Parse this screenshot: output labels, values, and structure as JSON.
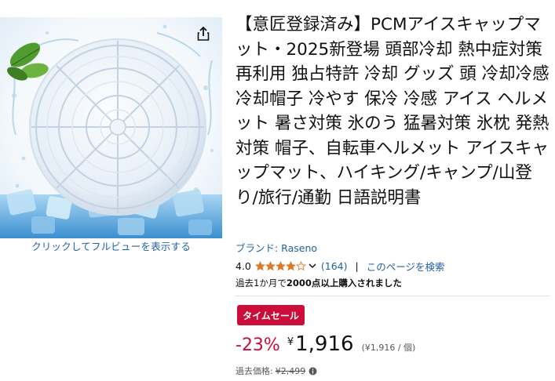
{
  "image": {
    "share_icon": "share-icon",
    "fullview_label": "クリックしてフルビューを表示する"
  },
  "product": {
    "title": "【意匠登録済み】PCMアイスキャップマット・2025新登場 頭部冷却 熱中症対策 再利用 独占特許 冷却 グッズ 頭 冷却冷感 冷却帽子 冷やす 保冷 冷感 アイス ヘルメット 暑さ対策 氷のう 猛暑対策 氷枕 発熱対策 帽子、自転車ヘルメット アイスキャップマット、ハイキング/キャンプ/山登り/旅行/通勤 日語説明書",
    "brand_label": "ブランド: Raseno"
  },
  "rating": {
    "value": "4.0",
    "stars": 4.0,
    "review_count": "(164)",
    "separator": "|",
    "search_link": "このページを検索",
    "star_color": "#de7921"
  },
  "sales": {
    "bought_prefix": "過去1か月で",
    "bought_bold": "2000点以上購入されました"
  },
  "deal": {
    "badge_label": "タイムセール",
    "badge_color": "#cc0c39"
  },
  "price": {
    "discount": "-23%",
    "currency": "¥",
    "amount": "1,916",
    "unit_price": "(¥1,916 / 個)",
    "list_label": "過去価格:",
    "list_price": "¥2,499",
    "info_icon": "info-icon"
  },
  "colors": {
    "link": "#2162a1",
    "text": "#0f1111",
    "muted": "#565959"
  }
}
